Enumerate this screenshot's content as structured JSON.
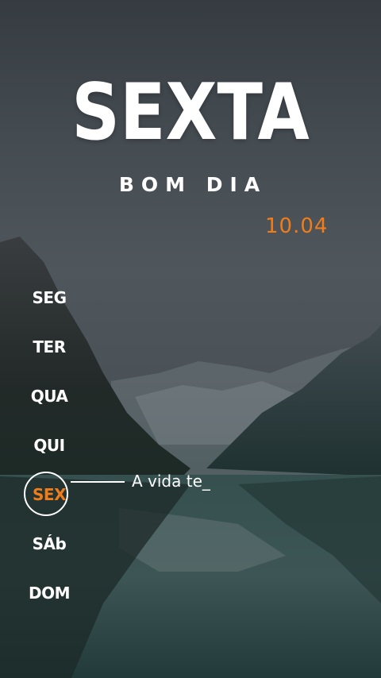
{
  "header": {
    "day_title": "SEXTA",
    "greeting": "BOM DIA",
    "date": "10.04"
  },
  "weekdays": [
    {
      "label": "SEG",
      "active": false
    },
    {
      "label": "TER",
      "active": false
    },
    {
      "label": "QUA",
      "active": false
    },
    {
      "label": "QUI",
      "active": false
    },
    {
      "label": "SEX",
      "active": true
    },
    {
      "label": "SÁb",
      "active": false
    },
    {
      "label": "DOM",
      "active": false
    }
  ],
  "message": {
    "text": "A vida te_"
  },
  "colors": {
    "accent": "#f07d1a",
    "text": "#ffffff",
    "sky": "#4b5258",
    "lake": "#2c4747"
  },
  "background": {
    "scene": "mountain-lake-wallpaper"
  }
}
